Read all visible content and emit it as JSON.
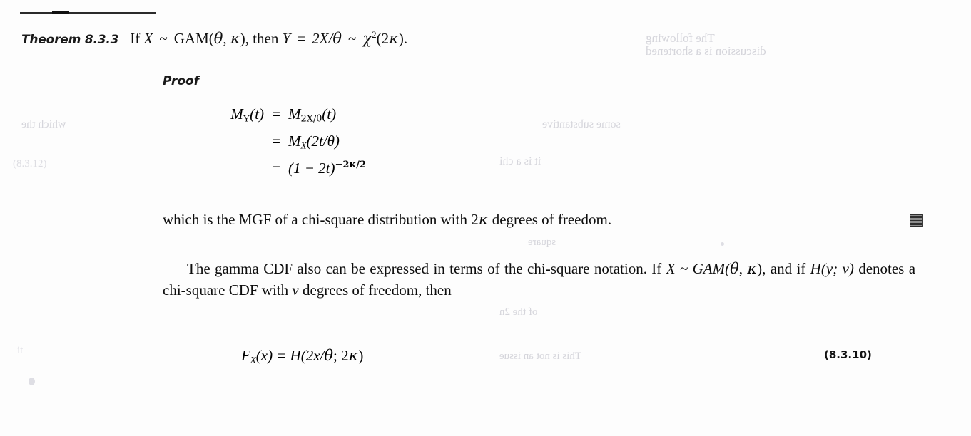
{
  "page": {
    "background_color": "#fdfdfd",
    "text_color": "#0d0d0d",
    "rule_color": "#2b2b2b"
  },
  "theorem": {
    "label": "Theorem 8.3.3",
    "statement_if": "If",
    "random_var": "X",
    "tilde": "~",
    "distribution": "GAM(",
    "theta": "θ",
    "comma": ", ",
    "kappa": "κ",
    "close_then": "), then",
    "y_var": "Y",
    "equals": "=",
    "expr": "2X/",
    "theta2": "θ",
    "tilde2": "~",
    "chi": "χ",
    "chi_exp": "2",
    "chi_arg": "(2",
    "kappa2": "κ",
    "period": ")."
  },
  "proof": {
    "heading": "Proof",
    "equations": [
      {
        "lhs_m": "M",
        "lhs_sub": "Y",
        "lhs_arg": "(t)",
        "eq": "=",
        "rhs_m": "M",
        "rhs_sub": "2X/θ",
        "rhs_arg": "(t)"
      },
      {
        "lhs_m": "",
        "lhs_sub": "",
        "lhs_arg": "",
        "eq": "=",
        "rhs_m": "M",
        "rhs_sub": "X",
        "rhs_arg": "(2t/θ)"
      },
      {
        "lhs_m": "",
        "lhs_sub": "",
        "lhs_arg": "",
        "eq": "=",
        "rhs_m": "(1 − 2t)",
        "rhs_sub": "",
        "rhs_arg": "−2κ/2"
      }
    ],
    "conclusion_pre": "which is the MGF of a chi-square distribution with 2",
    "conclusion_kappa": "κ",
    "conclusion_post": " degrees of freedom.",
    "tombstone": "qed-tombstone"
  },
  "paragraph": {
    "line1": "The gamma CDF also can be expressed in terms of the chi-square notation. If",
    "line2_pre": "X ~ GAM(",
    "line2_theta": "θ",
    "line2_mid": ", ",
    "line2_kappa": "κ",
    "line2_post": "), and if ",
    "line2_H": "H",
    "line2_Harg": "(y; v)",
    "line2_tail": " denotes a chi-square CDF with ",
    "line2_v": "v",
    "line2_end": " degrees of",
    "line3": "freedom, then"
  },
  "final_equation": {
    "F": "F",
    "F_sub": "X",
    "F_arg": "(x)",
    "equals": "=",
    "H": "H",
    "H_arg_pre": "(2x/",
    "H_theta": "θ",
    "H_arg_mid": "; 2",
    "H_kappa": "κ",
    "H_arg_close": ")",
    "number": "(8.3.10)"
  },
  "scan_artifacts": {
    "ghost_text_note": "faint mirrored show-through from reverse page",
    "ghosts": [
      "The following",
      "discussion is a shortened",
      "some substantive",
      "which the",
      "(8.3.12)",
      "it is a chi",
      "square",
      "of the 2n",
      "This is not an issue",
      "it"
    ]
  }
}
